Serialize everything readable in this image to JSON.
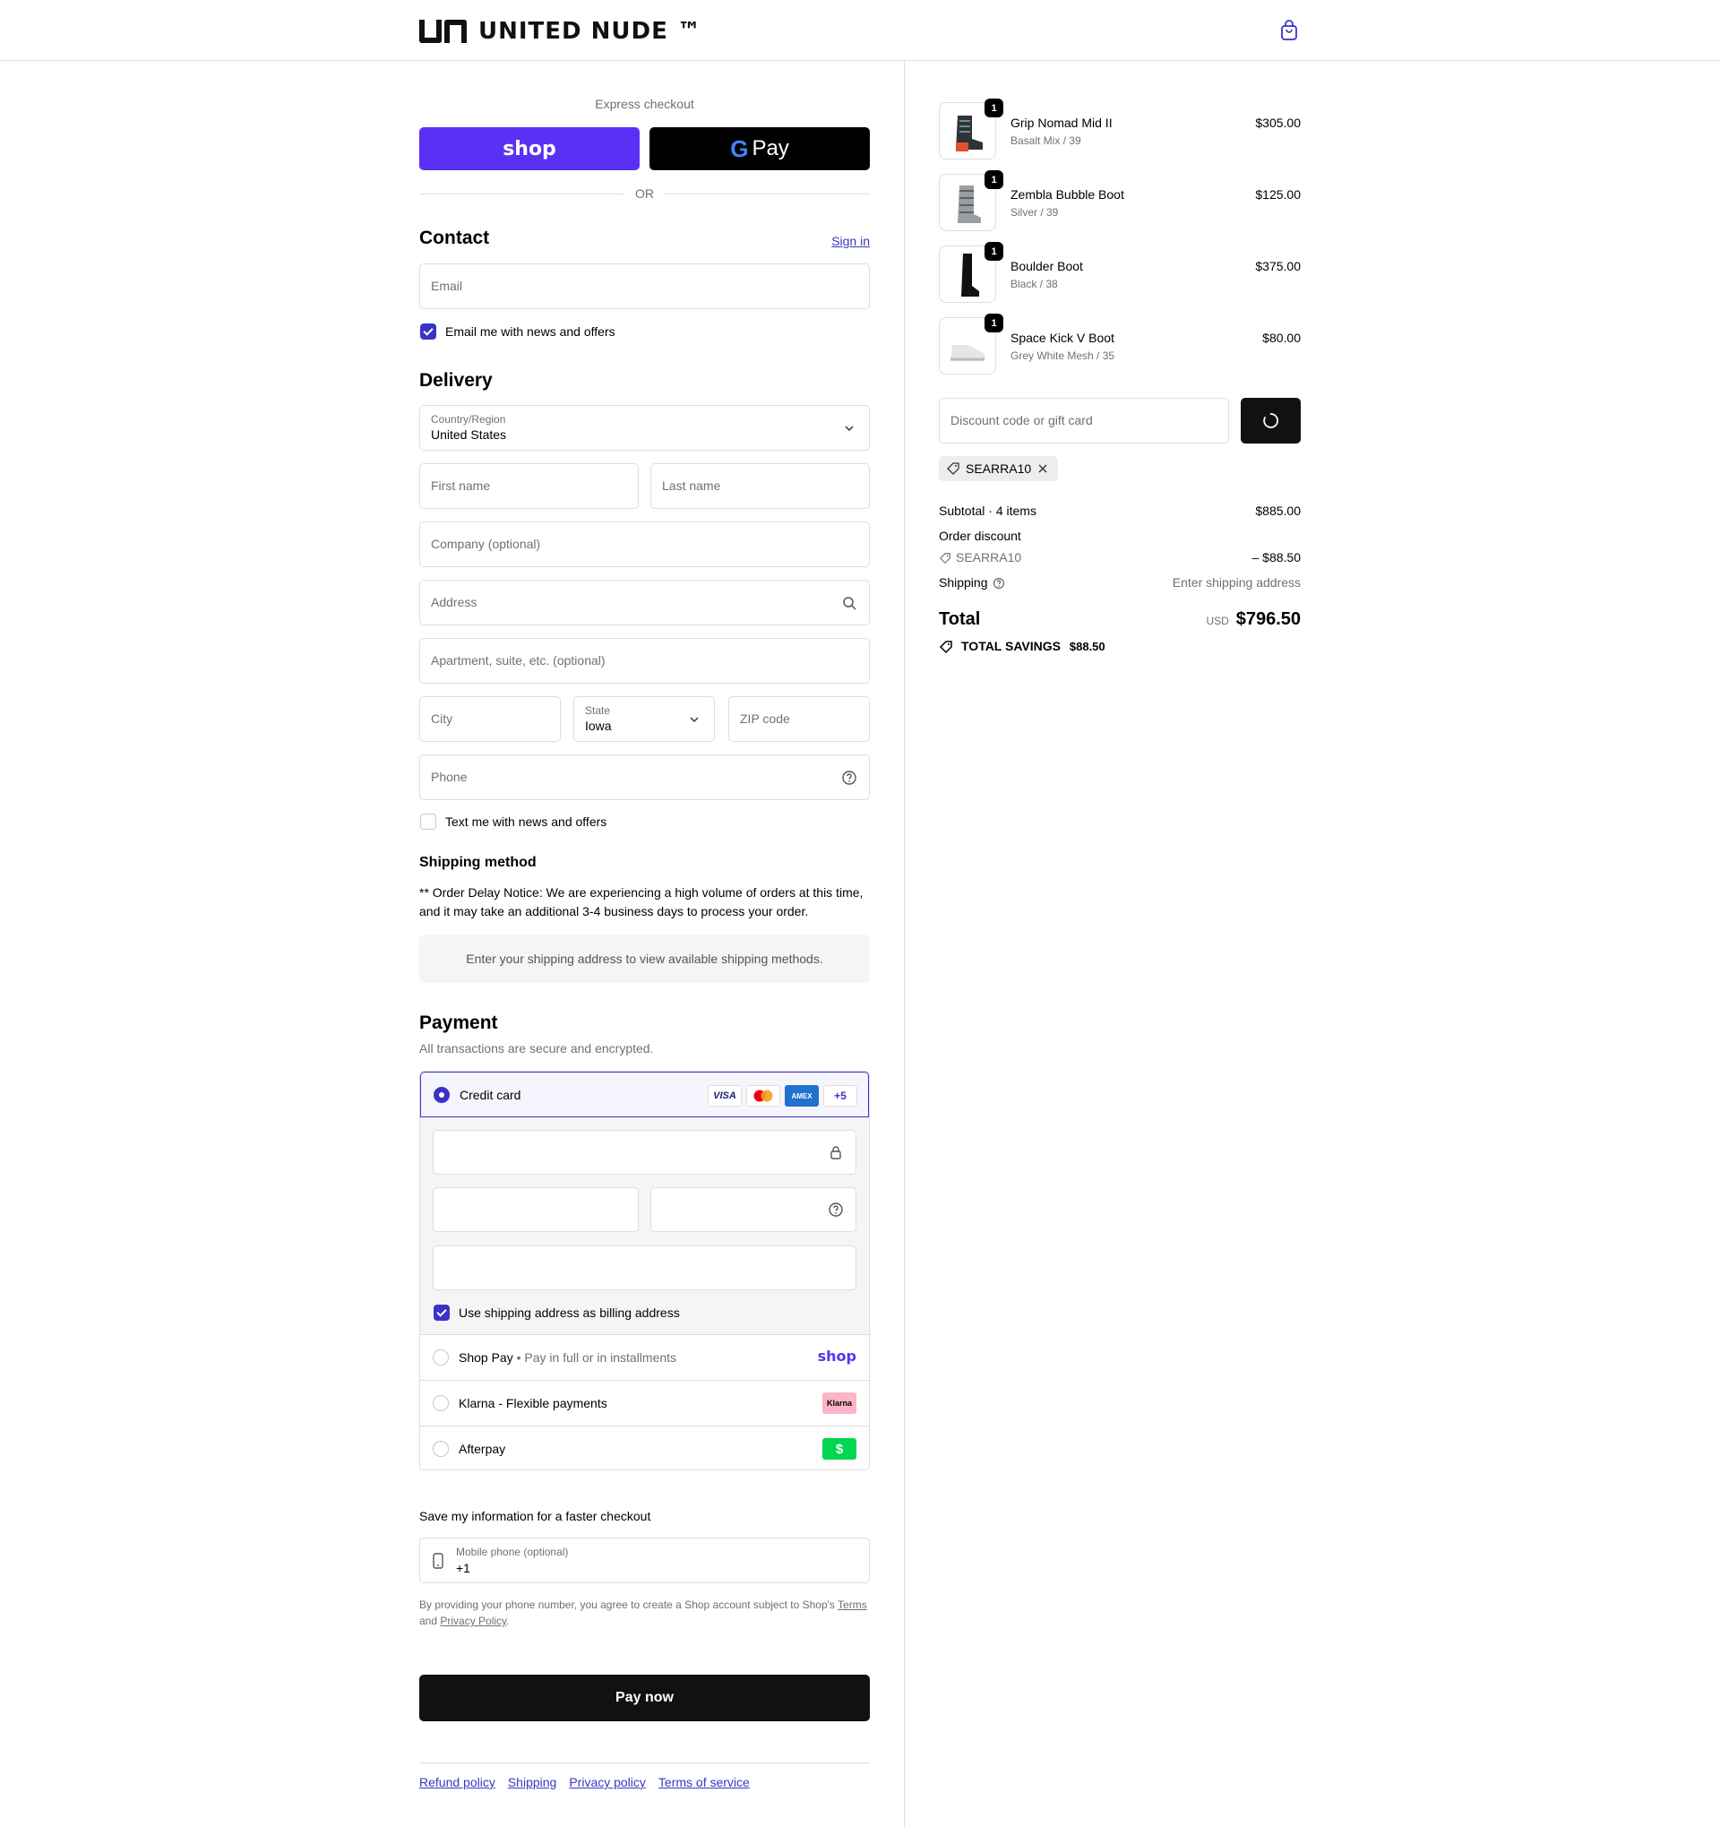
{
  "header": {
    "brand": "UNITED NUDE ™"
  },
  "express": {
    "label": "Express checkout",
    "shop_pay": "shop",
    "gpay_g": "G",
    "gpay_label": "Pay",
    "or": "OR"
  },
  "contact": {
    "heading": "Contact",
    "sign_in": "Sign in",
    "email_placeholder": "Email",
    "email_offers": "Email me with news and offers"
  },
  "delivery": {
    "heading": "Delivery",
    "country_label": "Country/Region",
    "country_value": "United States",
    "first_name": "First name",
    "last_name": "Last name",
    "company": "Company (optional)",
    "address": "Address",
    "apartment": "Apartment, suite, etc. (optional)",
    "city": "City",
    "state_label": "State",
    "state_value": "Iowa",
    "zip": "ZIP code",
    "phone": "Phone",
    "text_offers": "Text me with news and offers"
  },
  "shipping_method": {
    "heading": "Shipping method",
    "notice_line1": "** Order Delay Notice: We are experiencing a high volume of orders at this time,",
    "notice_line2": "and it may take an additional 3-4 business days to process your order.",
    "placeholder": "Enter your shipping address to view available shipping methods."
  },
  "payment": {
    "heading": "Payment",
    "subtitle": "All transactions are secure and encrypted.",
    "credit_card": "Credit card",
    "cards": [
      "VISA",
      "AMEX",
      "+5"
    ],
    "billing_same": "Use shipping address as billing address",
    "shop_pay": "Shop Pay",
    "shop_pay_sub": "Pay in full or in installments",
    "shop_pay_logo": "shop",
    "klarna": "Klarna - Flexible payments",
    "klarna_logo": "Klarna",
    "afterpay": "Afterpay",
    "afterpay_logo": "$"
  },
  "save_info": {
    "heading": "Save my information for a faster checkout",
    "mobile_label": "Mobile phone (optional)",
    "mobile_value": "+1",
    "legal_1": "By providing your phone number, you agree to create a Shop account subject to Shop's",
    "terms": "Terms",
    "and": "and",
    "privacy": "Privacy Policy",
    "period": "."
  },
  "pay_now": "Pay now",
  "footer": {
    "links": [
      "Refund policy",
      "Shipping",
      "Privacy policy",
      "Terms of service"
    ]
  },
  "summary": {
    "items": [
      {
        "name": "Grip Nomad Mid II",
        "variant": "Basalt Mix / 39",
        "price": "$305.00",
        "qty": "1"
      },
      {
        "name": "Zembla Bubble Boot",
        "variant": "Silver / 39",
        "price": "$125.00",
        "qty": "1"
      },
      {
        "name": "Boulder Boot",
        "variant": "Black / 38",
        "price": "$375.00",
        "qty": "1"
      },
      {
        "name": "Space Kick V Boot",
        "variant": "Grey White Mesh / 35",
        "price": "$80.00",
        "qty": "1"
      }
    ],
    "discount_placeholder": "Discount code or gift card",
    "applied_code": "SEARRA10",
    "subtotal_label": "Subtotal · 4 items",
    "subtotal_value": "$885.00",
    "order_discount_label": "Order discount",
    "discount_code": "SEARRA10",
    "discount_value": "– $88.50",
    "shipping_label": "Shipping",
    "shipping_value": "Enter shipping address",
    "total_label": "Total",
    "currency": "USD",
    "total_value": "$796.50",
    "savings_label": "TOTAL SAVINGS",
    "savings_value": "$88.50"
  },
  "colors": {
    "accent": "#3a32c8",
    "shop_pay": "#5a31f4",
    "klarna": "#ffb3c7",
    "afterpay": "#00d64f"
  }
}
